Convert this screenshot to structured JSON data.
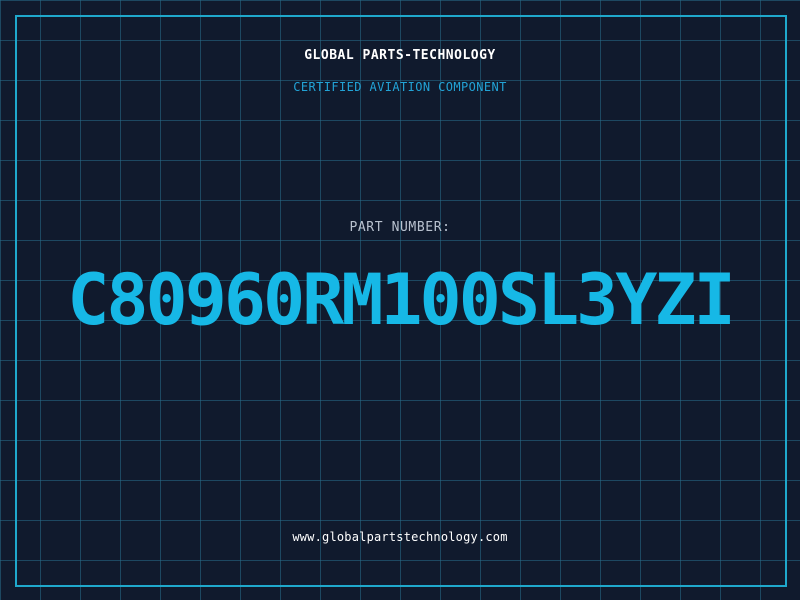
{
  "header": {
    "company": "GLOBAL PARTS-TECHNOLOGY",
    "subtitle": "CERTIFIED AVIATION COMPONENT"
  },
  "part": {
    "label": "PART NUMBER:",
    "number": "C80960RM100SL3YZI"
  },
  "footer": {
    "website": "www.globalpartstechnology.com"
  },
  "colors": {
    "background": "#101a2d",
    "accent": "#16b8e6",
    "grid": "#286e8c",
    "border": "#1fa8cc"
  }
}
